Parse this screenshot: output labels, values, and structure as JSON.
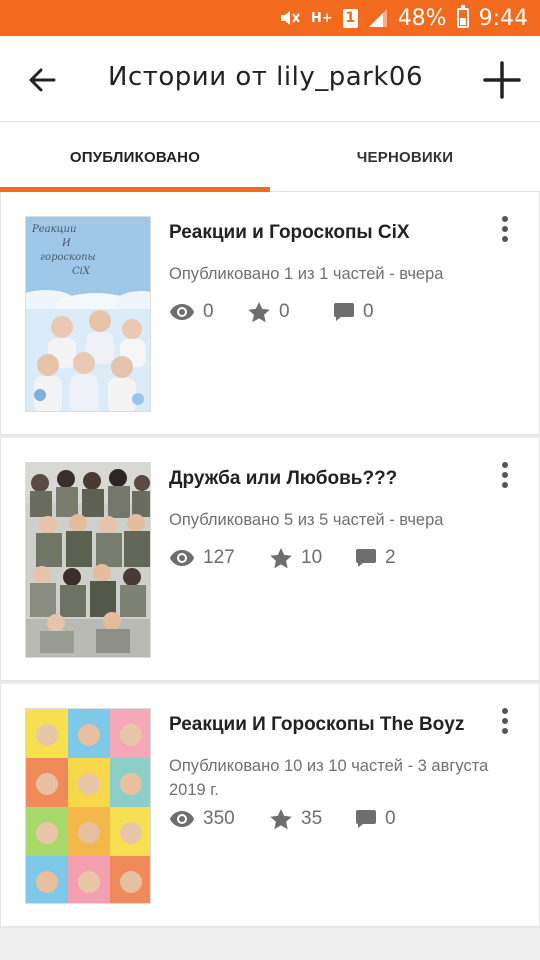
{
  "status_bar": {
    "battery_percent": "48%",
    "time": "9:44",
    "sim_label": "1",
    "network_label": "H+"
  },
  "app_bar": {
    "title": "Истории от lily_park06"
  },
  "tabs": [
    {
      "label": "ОПУБЛИКОВАНО",
      "selected": true
    },
    {
      "label": "ЧЕРНОВИКИ",
      "selected": false
    }
  ],
  "stories": [
    {
      "title": "Реакции и Гороскопы CiX",
      "meta": "Опубликовано 1 из 1 частей - вчера",
      "views": "0",
      "votes": "0",
      "comments": "0",
      "cover_text": [
        "Реакции",
        "И",
        "гороскопы",
        "CiX"
      ]
    },
    {
      "title": "Дружба или Любовь???",
      "meta": "Опубликовано 5 из 5 частей - вчера",
      "views": "127",
      "votes": "10",
      "comments": "2"
    },
    {
      "title": "Реакции И Гороскопы The Boyz",
      "meta": "Опубликовано 10 из 10 частей - 3 августа 2019 г.",
      "views": "350",
      "votes": "35",
      "comments": "0"
    }
  ],
  "colors": {
    "accent": "#f26a1d",
    "text_primary": "#222222",
    "text_secondary": "#707070"
  }
}
